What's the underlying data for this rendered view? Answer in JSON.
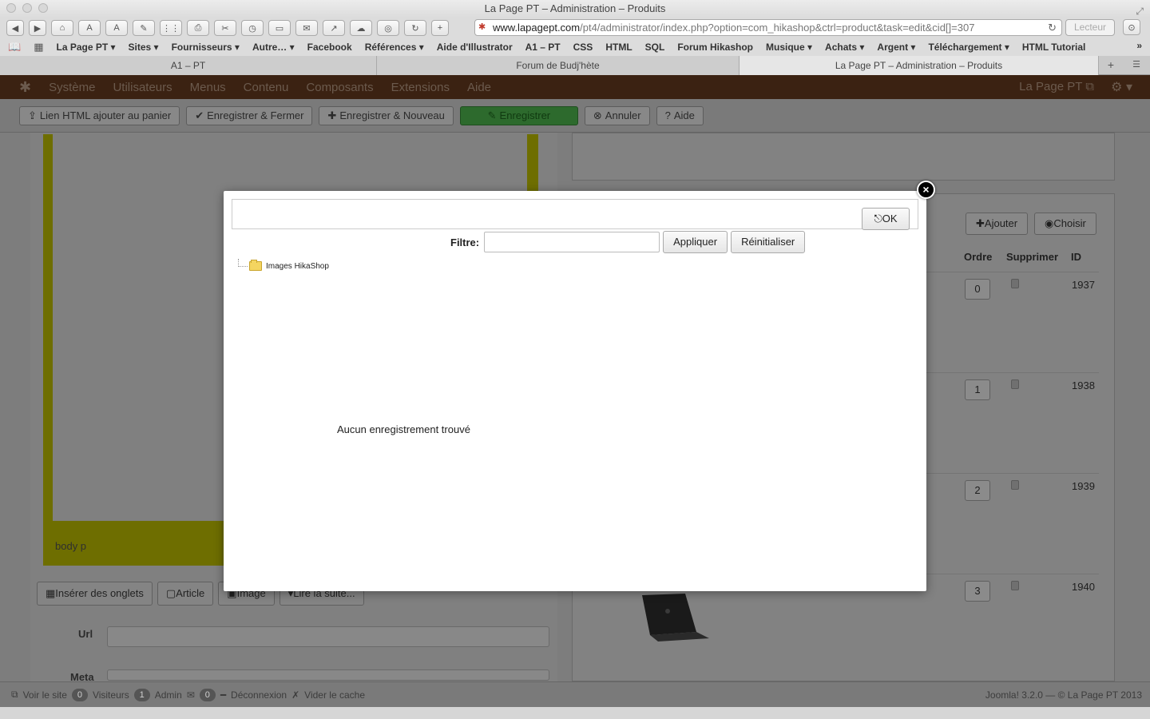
{
  "browser": {
    "window_title": "La Page PT – Administration – Produits",
    "url_host": "www.lapagept.com",
    "url_path": "/pt4/administrator/index.php?option=com_hikashop&ctrl=product&task=edit&cid[]=307",
    "reader_label": "Lecteur",
    "bookmarks": [
      "La Page PT ▾",
      "Sites ▾",
      "Fournisseurs ▾",
      "Autre… ▾",
      "Facebook",
      "Références ▾",
      "Aide d'Illustrator",
      "A1 – PT",
      "CSS",
      "HTML",
      "SQL",
      "Forum Hikashop",
      "Musique ▾",
      "Achats ▾",
      "Argent ▾",
      "Téléchargement ▾",
      "HTML Tutorial"
    ],
    "tabs": [
      "A1 – PT",
      "Forum de Budj'hète",
      "La Page PT – Administration – Produits"
    ]
  },
  "admin_nav": {
    "items": [
      "Système",
      "Utilisateurs",
      "Menus",
      "Contenu",
      "Composants",
      "Extensions",
      "Aide"
    ],
    "site_name": "La Page PT"
  },
  "admin_toolbar": {
    "html_link": "Lien HTML ajouter au panier",
    "save_close": "Enregistrer & Fermer",
    "save_new": "Enregistrer & Nouveau",
    "save": "Enregistrer",
    "cancel": "Annuler",
    "help": "Aide"
  },
  "editor": {
    "path": "body  p",
    "buttons": [
      "Insérer des onglets",
      "Article",
      "Image",
      "Lire la suite..."
    ],
    "url_label": "Url",
    "meta_label": "Meta"
  },
  "images_panel": {
    "add": "Ajouter",
    "choose": "Choisir",
    "col_order": "Ordre",
    "col_delete": "Supprimer",
    "col_id": "ID",
    "rows": [
      {
        "order": "0",
        "id": "1937"
      },
      {
        "order": "1",
        "id": "1938"
      },
      {
        "order": "2",
        "id": "1939"
      },
      {
        "order": "3",
        "id": "1940"
      }
    ]
  },
  "footer": {
    "view_site": "Voir le site",
    "visitors_count": "0",
    "visitors": "Visiteurs",
    "admin_count": "1",
    "admin": "Admin",
    "mail_count": "0",
    "logout": "Déconnexion",
    "clear_cache": "Vider le cache",
    "version": "Joomla! 3.2.0  —  © La Page PT 2013"
  },
  "modal": {
    "ok_label": "OK",
    "filter_label": "Filtre:",
    "filter_value": "",
    "apply": "Appliquer",
    "reset": "Réinitialiser",
    "folder_name": "Images HikaShop",
    "empty_message": "Aucun enregistrement trouvé"
  }
}
